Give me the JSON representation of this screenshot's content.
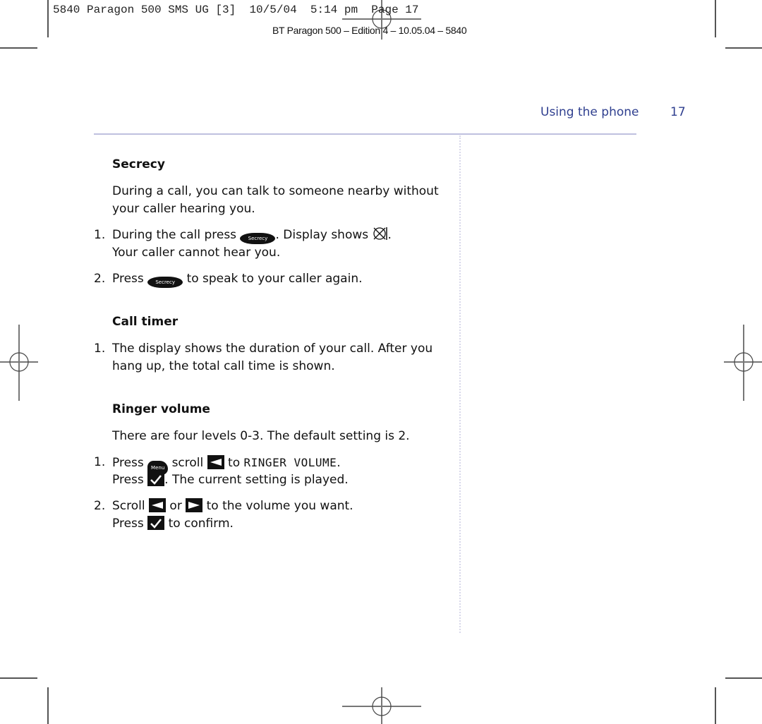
{
  "slug": {
    "file": "5840 Paragon 500 SMS UG [3]",
    "date": "10/5/04",
    "time": "5:14 pm",
    "page": "Page 17"
  },
  "edition_line": "BT Paragon 500 – Edition 4 – 10.05.04 – 5840",
  "header": {
    "running_head": "Using the phone",
    "page_number": "17",
    "accent_color": "#2f3f8f"
  },
  "sections": {
    "secrecy": {
      "title": "Secrecy",
      "intro_1": "During a call, you can talk to someone nearby without",
      "intro_2": "your caller hearing you.",
      "step1": {
        "num": "1.",
        "a": "During the call press",
        "key": "Secrecy",
        "b": ". Display shows",
        "c": ".",
        "line2": "Your caller cannot hear you."
      },
      "step2": {
        "num": "2.",
        "a": "Press",
        "key": "Secrecy",
        "b": "to speak to your caller again."
      }
    },
    "call_timer": {
      "title": "Call timer",
      "step1": {
        "num": "1.",
        "line1": "The display shows the duration of your call. After you",
        "line2": "hang up, the total call time is shown."
      }
    },
    "ringer_volume": {
      "title": "Ringer volume",
      "intro": "There are four levels 0-3. The default setting is 2.",
      "step1": {
        "num": "1.",
        "a": "Press",
        "menu_key": "Menu",
        "b": "scroll",
        "c": "to",
        "display_text": "RINGER VOLUME",
        "d": ".",
        "line2_a": "Press",
        "line2_b": ". The current setting is played."
      },
      "step2": {
        "num": "2.",
        "a": "Scroll",
        "b": "or",
        "c": "to the volume you want.",
        "line2_a": "Press",
        "line2_b": "to confirm."
      }
    }
  }
}
